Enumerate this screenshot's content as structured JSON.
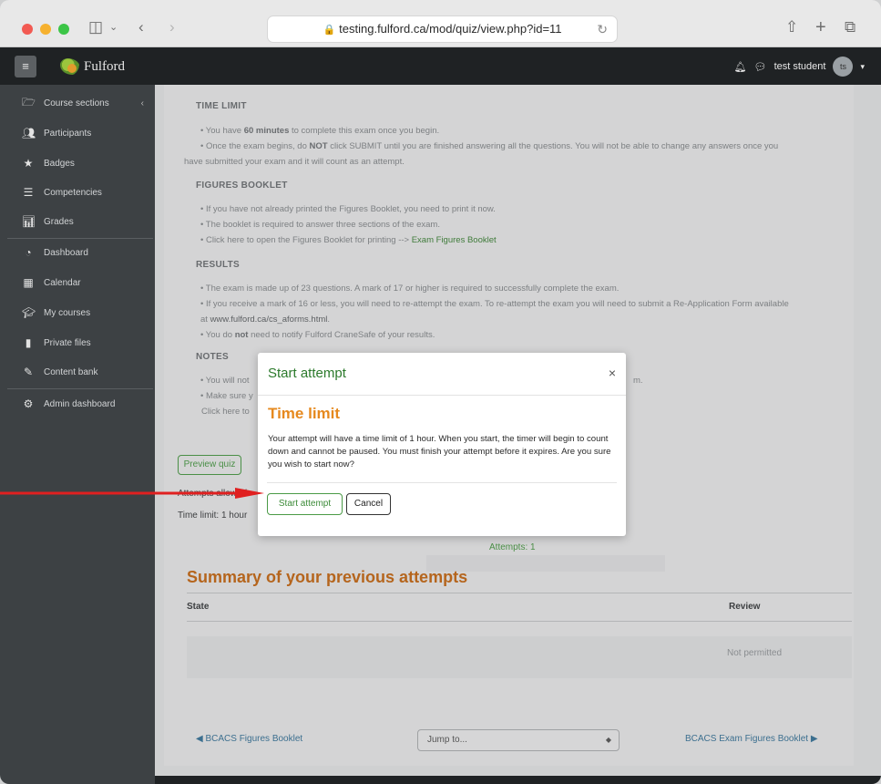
{
  "browser": {
    "url": "testing.fulford.ca/mod/quiz/view.php?id=11"
  },
  "navbar": {
    "logo_text": "Fulford",
    "user_name": "test student",
    "avatar_initials": "ts"
  },
  "sidebar": {
    "items": [
      {
        "label": "Course sections",
        "icon": "folder-icon"
      },
      {
        "label": "Participants",
        "icon": "users-icon"
      },
      {
        "label": "Badges",
        "icon": "star-icon"
      },
      {
        "label": "Competencies",
        "icon": "list-icon"
      },
      {
        "label": "Grades",
        "icon": "grades-icon"
      },
      {
        "label": "Dashboard",
        "icon": "dashboard-icon"
      },
      {
        "label": "Calendar",
        "icon": "calendar-icon"
      },
      {
        "label": "My courses",
        "icon": "graduation-cap-icon"
      },
      {
        "label": "Private files",
        "icon": "file-icon"
      },
      {
        "label": "Content bank",
        "icon": "brush-icon"
      },
      {
        "label": "Admin dashboard",
        "icon": "cogs-icon"
      }
    ]
  },
  "content": {
    "time_limit_heading": "TIME LIMIT",
    "time_limit_1_pre": "You have ",
    "time_limit_1_bold": "60 minutes",
    "time_limit_1_post": " to complete this exam once you begin.",
    "time_limit_2_pre": "Once the exam begins, do ",
    "time_limit_2_bold": "NOT",
    "time_limit_2_post": " click SUBMIT until you are finished answering all the questions. You will not be able to change any answers once you",
    "time_limit_2_cont": "have submitted your exam and it will count as an attempt.",
    "figures_heading": "FIGURES BOOKLET",
    "figures_1": "If you have not already printed the Figures Booklet, you need to print it now.",
    "figures_2": "The booklet is required to answer three sections of the exam.",
    "figures_3_pre": "Click here to open the Figures Booklet for printing --> ",
    "figures_3_link": "Exam Figures Booklet",
    "results_heading": "RESULTS",
    "results_1": "The exam is made up of 23 questions. A mark of 17 or higher is required to successfully complete the exam.",
    "results_2": "If you receive a mark of 16 or less, you will need to re-attempt the exam. To re-attempt the exam you will need to submit a Re-Application Form available",
    "results_2_cont_pre": "at ",
    "results_2_cont_link": "www.fulford.ca/cs_aforms.html",
    "results_2_cont_post": ".",
    "results_3_pre": "You do ",
    "results_3_bold": "not",
    "results_3_post": " need to notify Fulford CraneSafe of your results.",
    "notes_heading": "NOTES",
    "notes_1": "You will not",
    "notes_1_tail": "m.",
    "notes_2": "Make sure y",
    "notes_3": "Click here to",
    "preview_button": "Preview quiz",
    "attempts_allowed": "Attempts allowed:",
    "time_limit_info": "Time limit: 1 hour",
    "attempts_count": "Attempts: 1",
    "summary_heading": "Summary of your previous attempts",
    "col_state": "State",
    "col_review": "Review",
    "review_value": "Not permitted",
    "prev_link": "◀ BCACS Figures Booklet",
    "jump_placeholder": "Jump to...",
    "next_link": "BCACS Exam Figures Booklet ▶"
  },
  "modal": {
    "title": "Start attempt",
    "close": "×",
    "heading": "Time limit",
    "body": "Your attempt will have a time limit of 1 hour. When you start, the timer will begin to count down and cannot be paused. You must finish your attempt before it expires. Are you sure you wish to start now?",
    "start_button": "Start attempt",
    "cancel_button": "Cancel"
  },
  "colors": {
    "accent_green": "#3b8a37",
    "heading_orange": "#e6891e",
    "annotation_red": "#e02020"
  }
}
